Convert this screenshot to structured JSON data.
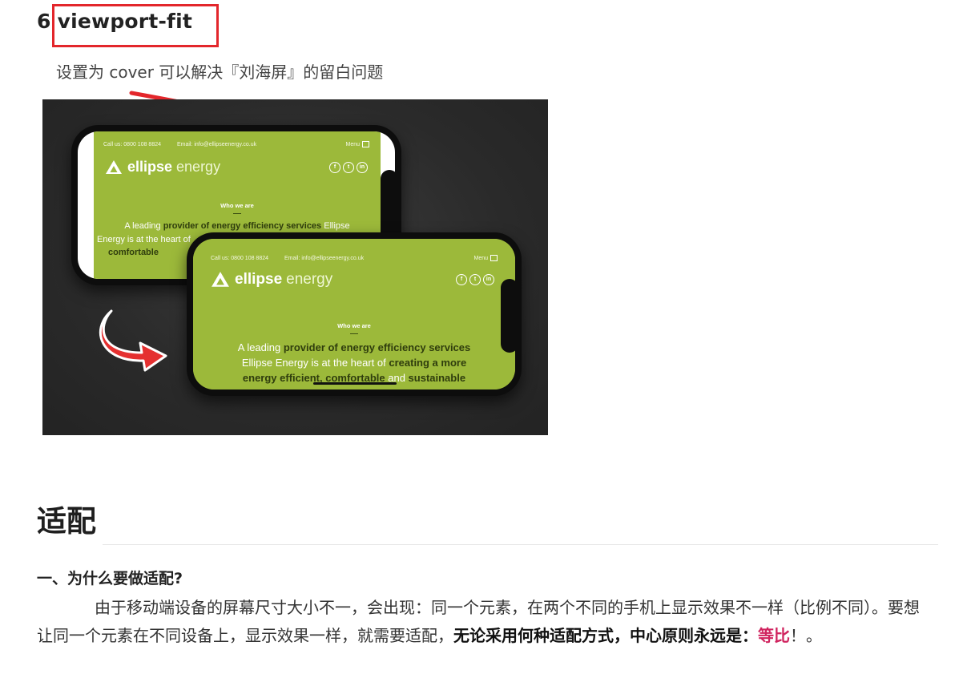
{
  "section": {
    "number": "6",
    "title": "viewport-fit",
    "description": "设置为 cover 可以解决『刘海屏』的留白问题"
  },
  "hero": {
    "phone_top": {
      "call": "Call us: 0800 108 8824",
      "email": "Email: info@ellipseenergy.co.uk",
      "menu": "Menu",
      "brand_bold": "ellipse",
      "brand_light": "energy",
      "who": "Who we are",
      "lead_1a": "A leading ",
      "lead_1b": "provider of energy efficiency services",
      "lead_1c": " Ellipse",
      "lead_2": "Energy is at the heart of",
      "lead_3": "comfortable"
    },
    "phone_bottom": {
      "call": "Call us: 0800 108 8824",
      "email": "Email: info@ellipseenergy.co.uk",
      "menu": "Menu",
      "brand_bold": "ellipse",
      "brand_light": "energy",
      "who": "Who we are",
      "lead_1a": "A leading ",
      "lead_1b": "provider of energy efficiency services",
      "lead_2a": "Ellipse Energy is at the heart of ",
      "lead_2b": "creating a more",
      "lead_3a": "energy efficient, comfortable",
      "lead_3b": " and ",
      "lead_3c": "sustainable"
    },
    "social_icons": [
      "facebook-icon",
      "twitter-icon",
      "linkedin-icon"
    ],
    "brand_color": "#9cb93a"
  },
  "adapt": {
    "heading": "适配",
    "subheading": "一、为什么要做适配?",
    "para_normal": "由于移动端设备的屏幕尺寸大小不一，会出现：同一个元素，在两个不同的手机上显示效果不一样（比例不同）。要想让同一个元素在不同设备上，显示效果一样，就需要适配，",
    "para_bold": "无论采用何种适配方式，中心原则永远是：",
    "para_emph": "等比",
    "para_end": "！。"
  },
  "colors": {
    "highlight_red": "#e3262b",
    "emphasis_pink": "#d0245f"
  }
}
